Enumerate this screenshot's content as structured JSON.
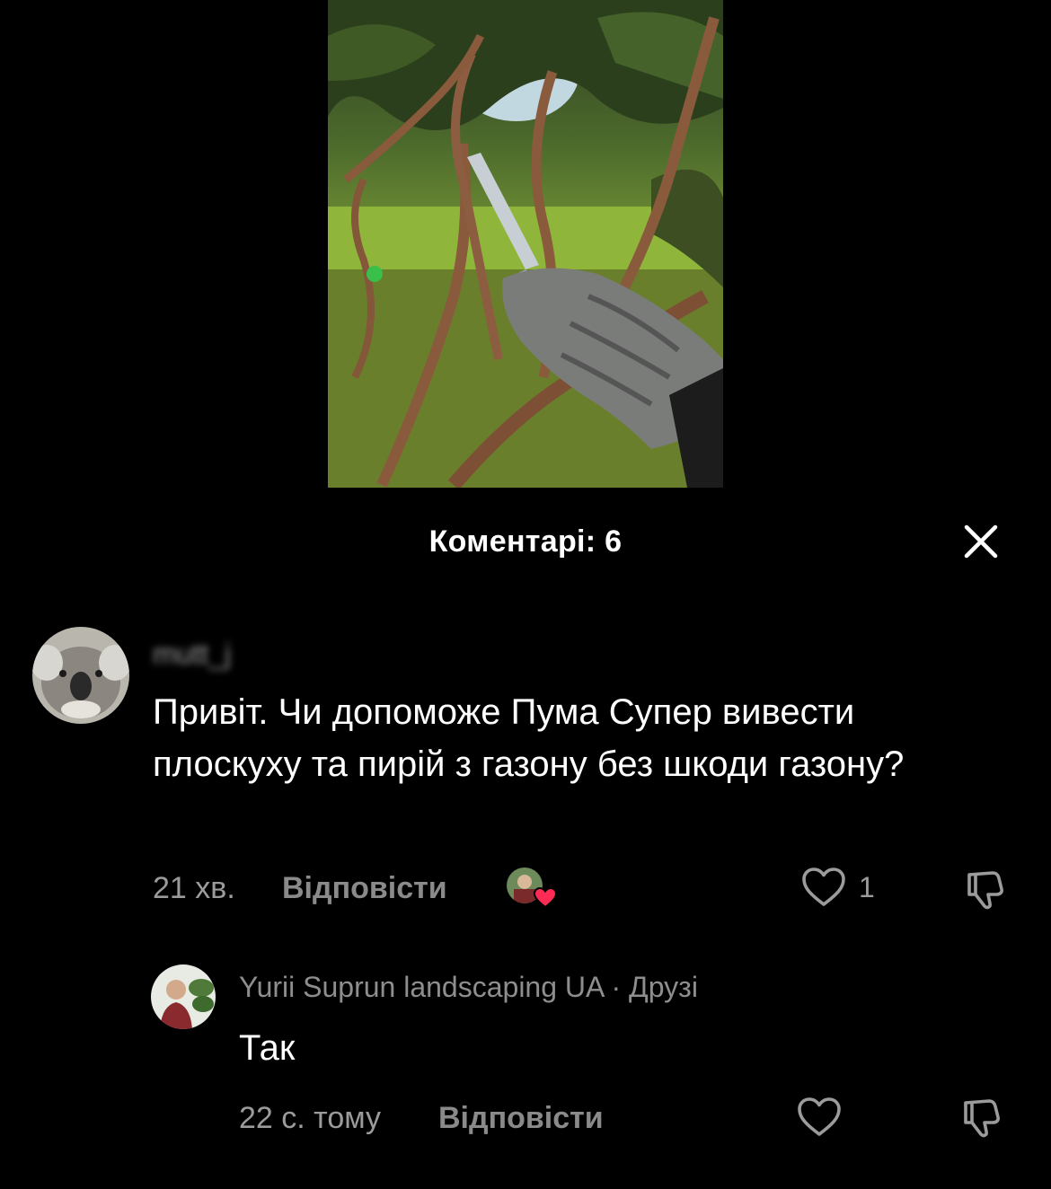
{
  "header": {
    "title": "Коментарі: 6"
  },
  "comments": [
    {
      "username": "mutt_j",
      "text": "Привіт. Чи допоможе Пума Супер вивести плоскуху та пирій з газону без шкоди газону?",
      "time": "21 хв.",
      "reply_label": "Відповісти",
      "likes": "1",
      "replies": [
        {
          "username": "Yurii Suprun landscaping UA",
          "badge": "· Друзі",
          "text": "Так",
          "time": "22 с. тому",
          "reply_label": "Відповісти"
        }
      ]
    }
  ],
  "colors": {
    "background": "#000000",
    "muted_text": "#9b9b9b",
    "heart_badge": "#fe2c55"
  },
  "icons": {
    "close": "close-icon",
    "like": "heart-outline-icon",
    "dislike": "thumb-down-icon",
    "creator_liked": "heart-filled-icon"
  }
}
